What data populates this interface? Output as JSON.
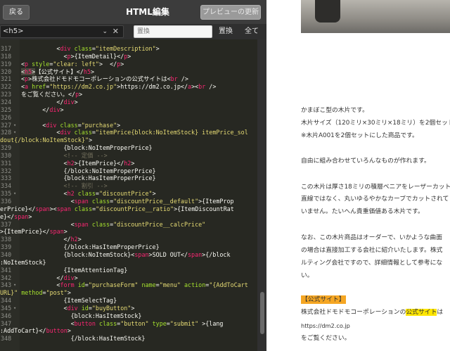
{
  "header": {
    "back_label": "戻る",
    "title": "HTML編集",
    "preview_label": "プレビューの更新"
  },
  "toolbar": {
    "tag_value": "<h5>",
    "search_placeholder": "置換",
    "replace_label": "置換",
    "all_label": "全て"
  },
  "code_lines": [
    {
      "n": "317",
      "html": "<span class=\"p\">          &lt;</span><span class=\"t\">div</span> <span class=\"a\">class</span>=<span class=\"s\">\"itemDescription\"</span><span class=\"p\">&gt;</span>"
    },
    {
      "n": "318",
      "html": "<span class=\"p\">            &lt;</span><span class=\"t\">p</span><span class=\"p\">&gt;{ItemDetail}&lt;/</span><span class=\"t\">p</span><span class=\"p\">&gt;</span>"
    },
    {
      "n": "319",
      "html": "<span class=\"p\">&lt;</span><span class=\"t\">p</span> <span class=\"a\">style</span>=<span class=\"s\">\"clear: left\"</span><span class=\"p\">&gt;  &lt;/</span><span class=\"t\">p</span><span class=\"p\">&gt;</span>"
    },
    {
      "n": "320",
      "html": "<span class=\"p h5hl\">&lt;</span><span class=\"t h5hl\">h5</span><span class=\"p h5hl\">&gt;</span><span class=\"p\">【公式サイト】&lt;/</span><span class=\"t\">h5</span><span class=\"p\">&gt;</span>"
    },
    {
      "n": "321",
      "html": "<span class=\"p\">&lt;</span><span class=\"t\">p</span><span class=\"p\">&gt;株式会社ドモドモコーポレーションの公式サイトは&lt;</span><span class=\"t\">br</span> <span class=\"p\">/&gt;</span>"
    },
    {
      "n": "322",
      "html": "<span class=\"p\">&lt;</span><span class=\"t\">a</span> <span class=\"a\">href</span>=<span class=\"s\">\"https://dm2.co.jp\"</span><span class=\"p\">&gt;https://dm2.co.jp&lt;/</span><span class=\"t\">a</span><span class=\"p\">&gt;&lt;</span><span class=\"t\">br</span> <span class=\"p\">/&gt;</span>"
    },
    {
      "n": "323",
      "html": "<span class=\"p\">をご覧ください。&lt;/</span><span class=\"t\">p</span><span class=\"p\">&gt;</span>"
    },
    {
      "n": "324",
      "html": "<span class=\"p\">          &lt;/</span><span class=\"t\">div</span><span class=\"p\">&gt;</span>"
    },
    {
      "n": "325",
      "html": "<span class=\"p\">      &lt;/</span><span class=\"t\">div</span><span class=\"p\">&gt;</span>"
    },
    {
      "n": "326",
      "html": ""
    },
    {
      "n": "327",
      "fold": true,
      "html": "<span class=\"p\">      &lt;</span><span class=\"t\">div</span> <span class=\"a\">class</span>=<span class=\"s\">\"purchase\"</span><span class=\"p\">&gt;</span>"
    },
    {
      "n": "328",
      "fold": true,
      "html": "<span class=\"p\">          &lt;</span><span class=\"t\">div</span> <span class=\"a\">class</span>=<span class=\"s\">\"itemPrice{block:NoItemStock} itemPrice_sol</span>"
    },
    {
      "n": "",
      "wrap": true,
      "html": "<span class=\"s\">dout{/block:NoItemStock}\"</span><span class=\"p\">&gt;</span>"
    },
    {
      "n": "329",
      "html": "<span class=\"p\">            {block:NoItemProperPrice}</span>"
    },
    {
      "n": "330",
      "html": "<span class=\"c\">            &lt;!-- 定価 --&gt;</span>"
    },
    {
      "n": "331",
      "html": "<span class=\"p\">            &lt;</span><span class=\"t\">h2</span><span class=\"p\">&gt;{ItemPrice}&lt;/</span><span class=\"t\">h2</span><span class=\"p\">&gt;</span>"
    },
    {
      "n": "332",
      "html": "<span class=\"p\">            {/block:NoItemProperPrice}</span>"
    },
    {
      "n": "333",
      "html": "<span class=\"p\">            {block:HasItemProperPrice}</span>"
    },
    {
      "n": "334",
      "html": "<span class=\"c\">            &lt;!-- 割引 --&gt;</span>"
    },
    {
      "n": "335",
      "fold": true,
      "html": "<span class=\"p\">            &lt;</span><span class=\"t\">h2</span> <span class=\"a\">class</span>=<span class=\"s\">\"discountPrice\"</span><span class=\"p\">&gt;</span>"
    },
    {
      "n": "336",
      "html": "<span class=\"p\">              &lt;</span><span class=\"t\">span</span> <span class=\"a\">class</span>=<span class=\"s\">\"discountPrice__default\"</span><span class=\"p\">&gt;{ItemProp</span>"
    },
    {
      "n": "",
      "wrap": true,
      "html": "<span class=\"p\">erPrice}&lt;/</span><span class=\"t\">span</span><span class=\"p\">&gt;&lt;</span><span class=\"t\">span</span> <span class=\"a\">class</span>=<span class=\"s\">\"discountPrice__ratio\"</span><span class=\"p\">&gt;{ItemDiscountRat</span>"
    },
    {
      "n": "",
      "wrap": true,
      "html": "<span class=\"p\">e}&lt;/</span><span class=\"t\">span</span><span class=\"p\">&gt;</span>"
    },
    {
      "n": "337",
      "html": "<span class=\"p\">              &lt;</span><span class=\"t\">span</span> <span class=\"a\">class</span>=<span class=\"s\">\"discountPrice__calcPrice\"</span>"
    },
    {
      "n": "",
      "wrap": true,
      "html": "<span class=\"p\">&gt;{ItemPrice}&lt;/</span><span class=\"t\">span</span><span class=\"p\">&gt;</span>"
    },
    {
      "n": "338",
      "html": "<span class=\"p\">            &lt;/</span><span class=\"t\">h2</span><span class=\"p\">&gt;</span>"
    },
    {
      "n": "339",
      "html": "<span class=\"p\">            {/block:HasItemProperPrice}</span>"
    },
    {
      "n": "340",
      "html": "<span class=\"p\">            {block:NoItemStock}&lt;</span><span class=\"t\">span</span><span class=\"p\">&gt;SOLD OUT&lt;/</span><span class=\"t\">span</span><span class=\"p\">&gt;{/block</span>"
    },
    {
      "n": "",
      "wrap": true,
      "html": "<span class=\"p\">:NoItemStock}</span>"
    },
    {
      "n": "341",
      "html": "<span class=\"p\">            {ItemAttentionTag}</span>"
    },
    {
      "n": "342",
      "html": "<span class=\"p\">          &lt;/</span><span class=\"t\">div</span><span class=\"p\">&gt;</span>"
    },
    {
      "n": "343",
      "fold": true,
      "html": "<span class=\"p\">          &lt;</span><span class=\"t\">form</span> <span class=\"a\">id</span>=<span class=\"s\">\"purchaseForm\"</span> <span class=\"a\">name</span>=<span class=\"s\">\"menu\"</span> <span class=\"a\">action</span>=<span class=\"s\">\"{AddToCart</span>"
    },
    {
      "n": "",
      "wrap": true,
      "html": "<span class=\"s\">URL}\"</span> <span class=\"a\">method</span>=<span class=\"s\">\"post\"</span><span class=\"p\">&gt;</span>"
    },
    {
      "n": "344",
      "html": "<span class=\"p\">            {ItemSelectTag}</span>"
    },
    {
      "n": "345",
      "fold": true,
      "html": "<span class=\"p\">            &lt;</span><span class=\"t\">div</span> <span class=\"a\">id</span>=<span class=\"s\">\"buyButton\"</span><span class=\"p\">&gt;</span>"
    },
    {
      "n": "346",
      "html": "<span class=\"p\">              {block:HasItemStock}</span>"
    },
    {
      "n": "347",
      "html": "<span class=\"p\">              &lt;</span><span class=\"t\">button</span> <span class=\"a\">class</span>=<span class=\"s\">\"button\"</span> <span class=\"a\">type</span>=<span class=\"s\">\"submit\"</span> <span class=\"p\">&gt;{lang</span>"
    },
    {
      "n": "",
      "wrap": true,
      "html": "<span class=\"p\">:AddToCart}&lt;/</span><span class=\"t\">button</span><span class=\"p\">&gt;</span>"
    },
    {
      "n": "348",
      "html": "<span class=\"p\">              {/block:HasItemStock}</span>"
    }
  ],
  "preview": {
    "paragraphs": [
      "かまぼこ型の木片です。",
      "木片サイズ（120ミリ×30ミリ×18ミリ）を2個セット",
      "※木片A001を2個セットにした商品です。",
      "自由に組み合わせていろんなものが作れます。",
      "この木片は厚さ18ミリの積層ベニアをレーザーカット",
      "直線ではなく、丸いゆるやかなカーブでカットされて",
      "いません。たいへん貴重価値ある木片です。",
      "なお、この木片商品はオーダーで、いかような曲面",
      "の場合は直接加工する会社に紹介いたします。株式",
      "ルティング会社ですので、詳細情報として参考にな",
      "い。"
    ],
    "heading": "【公式サイト】",
    "site_line_prefix": "株式会社ドモドモコーポレーションの",
    "site_line_highlight": "公式サイト",
    "site_line_suffix": "は",
    "url": "https://dm2.co.jp",
    "closing": "をご覧ください。"
  }
}
